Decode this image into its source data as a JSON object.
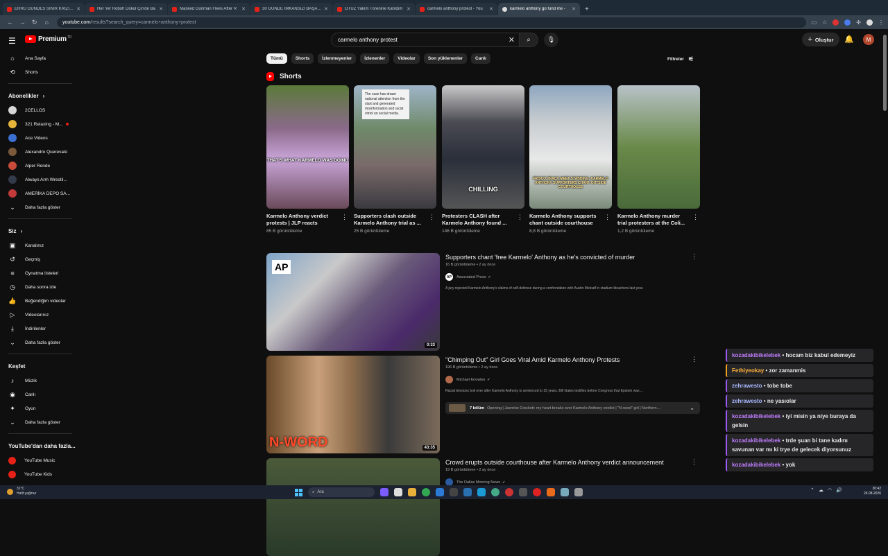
{
  "browser": {
    "tabs": [
      {
        "label": "ERRU GÜNDES SİNİR KRİZİ GEÇ"
      },
      {
        "label": "Her Yer Robot! Dokul Çin'de Ba"
      },
      {
        "label": "Masked Gunman Flees After R"
      },
      {
        "label": "30 GÜNDE İMKANSIZI BAŞARM"
      },
      {
        "label": "ÖTÜZ Yakım Törenine Katıldım"
      },
      {
        "label": "carmelo anthony protest - You"
      },
      {
        "label": "karmelo anthony go fund me -"
      }
    ],
    "new_tab": "+",
    "url_host": "youtube.com",
    "url_path": "/results?search_query=carmelo+anthony+protest"
  },
  "header": {
    "logo_text": "Premium",
    "logo_region": "TR",
    "search_value": "carmelo anthony protest",
    "create_label": "Oluştur",
    "avatar_letter": "M"
  },
  "sidebar": {
    "main": [
      {
        "label": "Ana Sayfa",
        "icon": "⌂"
      },
      {
        "label": "Shorts",
        "icon": "⟲"
      }
    ],
    "subs_title": "Abonelikler",
    "subs": [
      {
        "label": "2CELLOS",
        "color": "#d7d7d7",
        "live": false
      },
      {
        "label": "321 Relaxing - M...",
        "color": "#e3b33a",
        "live": true
      },
      {
        "label": "Ace Videos",
        "color": "#3b6fd1",
        "live": false
      },
      {
        "label": "Alexandro Querevalú",
        "color": "#7a5a3a",
        "live": false
      },
      {
        "label": "Alper Rende",
        "color": "#c94b3a",
        "live": false
      },
      {
        "label": "Always Arm Wrestli...",
        "color": "#333a4a",
        "live": false
      },
      {
        "label": "AMERİKA DEPO SA...",
        "color": "#c23a3a",
        "live": false
      }
    ],
    "more": "Daha fazla göster",
    "you_title": "Siz",
    "you": [
      {
        "label": "Kanalınız",
        "icon": "▣"
      },
      {
        "label": "Geçmiş",
        "icon": "↺"
      },
      {
        "label": "Oynatma listeleri",
        "icon": "≡"
      },
      {
        "label": "Daha sonra izle",
        "icon": "◷"
      },
      {
        "label": "Beğendiğim videolar",
        "icon": "👍"
      },
      {
        "label": "Videolarınız",
        "icon": "▷"
      },
      {
        "label": "İndirilenler",
        "icon": "⤓"
      }
    ],
    "more2": "Daha fazla göster",
    "explore_title": "Keşfet",
    "explore": [
      {
        "label": "Müzik",
        "icon": "♪"
      },
      {
        "label": "Canlı",
        "icon": "◉"
      },
      {
        "label": "Oyun",
        "icon": "✦"
      }
    ],
    "more3": "Daha fazla göster",
    "ytmore_title": "YouTube'dan daha fazla...",
    "ytmore": [
      {
        "label": "YouTube Music"
      },
      {
        "label": "YouTube Kids"
      }
    ]
  },
  "chips": [
    "Tümü",
    "Shorts",
    "İzlenmeyenler",
    "İzlenenler",
    "Videolar",
    "Son yüklenenler",
    "Canlı"
  ],
  "filters_label": "Filtreler",
  "shorts_title": "Shorts",
  "shorts": [
    {
      "title": "Karmelo Anthony verdict protests | JLP reacts",
      "views": "85 B görüntüleme",
      "caption": "THAT'S WHAT KARMELO WAS DOING"
    },
    {
      "title": "Supporters clash outside Karmelo Anthony trial as ...",
      "views": "25 B görüntüleme",
      "caption": "The case has drawn national attention from the start and generated misinformation and racist vitriol on social media."
    },
    {
      "title": "Protesters CLASH after Karmelo Anthony found ...",
      "views": "146 B görüntüleme",
      "caption": "CHILLING"
    },
    {
      "title": "Karmelo Anthony supports chant outside courthouse",
      "views": "8,8 B görüntüleme",
      "caption": "FRISCO TRACK MEET STABBING: KARMELO ANTHONY SUPPORTERS CHANT OUTSIDE COURTHOUSE"
    },
    {
      "title": "Karmelo Anthony murder trial protesters at the Coli...",
      "views": "1,2 B görüntüleme",
      "caption": ""
    }
  ],
  "videos": [
    {
      "title": "Supporters chant 'free Karmelo' Anthony as he's convicted of murder",
      "meta": "16 B görüntüleme • 2 ay önce",
      "channel": "Associated Press",
      "desc": "A jury rejected Karmelo Anthony's claims of self-defense during a confrontation with Austin Metcalf in stadium bleachers last year.",
      "duration": "0:33",
      "thumb_text": "AP"
    },
    {
      "title": "\"Chimping Out\" Girl Goes Viral Amid Karmelo Anthony Protests",
      "meta": "196 B görüntüleme • 2 ay önce",
      "channel": "Michael Knowles",
      "desc": "Racial tensions boil over after Karmelo Anthony is sentenced to 35 years, Bill Gates testifies before Congress that Epstein was ...",
      "duration": "43:35",
      "thumb_text": "N-WORD",
      "chapters_count": "7 bölüm",
      "chapters_text": "Opening | Jasmine Crockett: my heart breaks over Karmelo Anthony verdict | \"N-word\" girl | Northern..."
    },
    {
      "title": "Crowd erupts outside courthouse after Karmelo Anthony verdict announcement",
      "meta": "19 B görüntüleme • 2 ay önce",
      "channel": "The Dallas Morning News",
      "desc": ""
    }
  ],
  "chat": [
    {
      "user": "kozadakibikelebek",
      "text": "hocam biz kabul edemeyiz",
      "style": "p"
    },
    {
      "user": "Fethiyeokay",
      "text": "zor zamanmis",
      "style": "o"
    },
    {
      "user": "zehrawesto",
      "text": "tobe tobe",
      "style": "b"
    },
    {
      "user": "zehrawesto",
      "text": "ne yasıolar",
      "style": "b"
    },
    {
      "user": "kozadakibikelebek",
      "text": "iyi misin ya niye buraya da gelsin",
      "style": "p"
    },
    {
      "user": "kozadakibikelebek",
      "text": "trde şuan bi tane kadını savunan var mı ki trye de gelecek diyorsunuz",
      "style": "p"
    },
    {
      "user": "kozadakibikelebek",
      "text": "yok",
      "style": "p"
    }
  ],
  "taskbar": {
    "weather_temp": "31°C",
    "weather_desc": "Hafif yağmur",
    "search_label": "Ara",
    "time": "20:42",
    "date": "24.08.2026"
  }
}
